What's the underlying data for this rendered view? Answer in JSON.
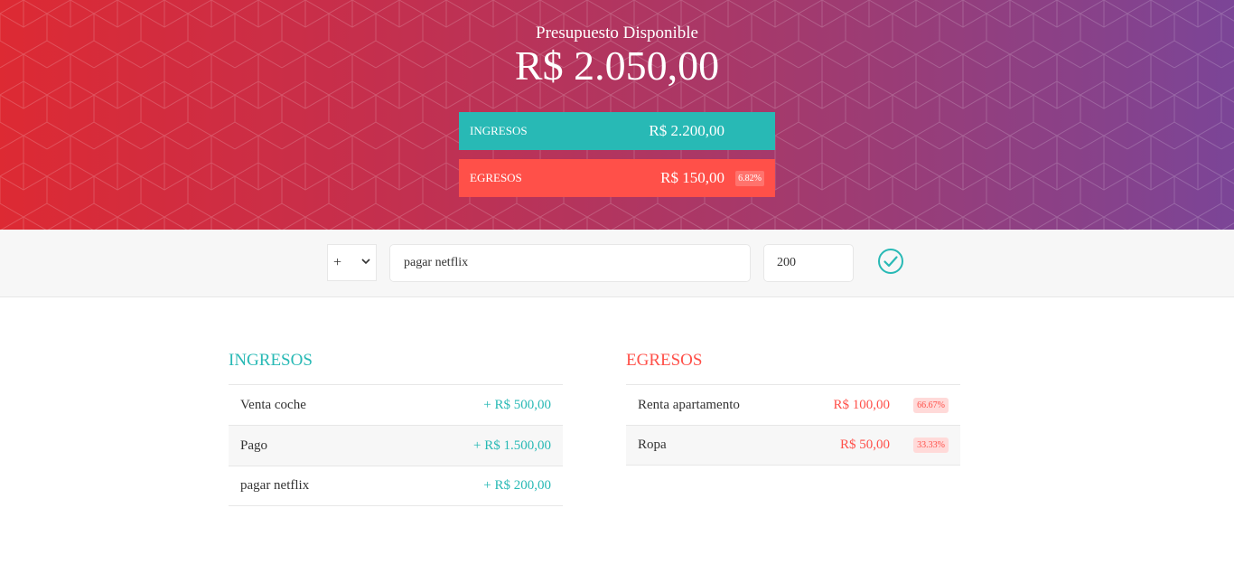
{
  "budget": {
    "title": "Presupuesto Disponible",
    "value": "R$ 2.050,00",
    "income": {
      "label": "INGRESOS",
      "value": "R$ 2.200,00"
    },
    "expense": {
      "label": "EGRESOS",
      "value": "R$ 150,00",
      "percentage": "6.82%"
    }
  },
  "add_form": {
    "type_selected": "+",
    "description_value": "pagar netflix",
    "amount_value": "200",
    "submit_icon": "check-circle-icon"
  },
  "income_list": {
    "title": "INGRESOS",
    "items": [
      {
        "description": "Venta coche",
        "value": "+ R$ 500,00"
      },
      {
        "description": "Pago",
        "value": "+ R$ 1.500,00"
      },
      {
        "description": "pagar netflix",
        "value": "+ R$ 200,00"
      }
    ]
  },
  "expense_list": {
    "title": "EGRESOS",
    "items": [
      {
        "description": "Renta apartamento",
        "value": "R$ 100,00",
        "percentage": "66.67%"
      },
      {
        "description": "Ropa",
        "value": "R$ 50,00",
        "percentage": "33.33%"
      }
    ]
  },
  "colors": {
    "income": "#28b9b5",
    "expense": "#ff5049",
    "gradient_start": "#dd2a33",
    "gradient_end": "#7b4597"
  }
}
